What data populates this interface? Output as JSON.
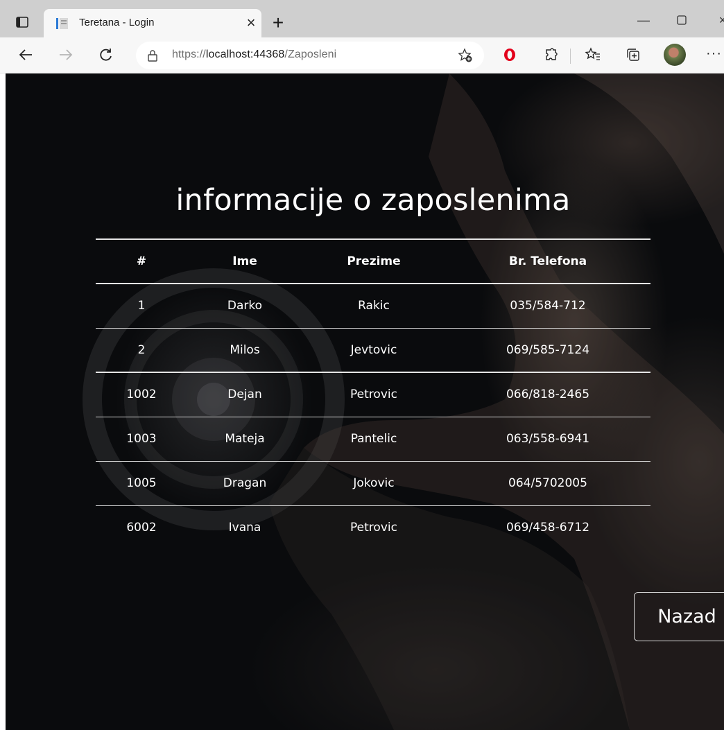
{
  "browser": {
    "tab_title": "Teretana - Login",
    "url_scheme": "https://",
    "url_host": "localhost:44368",
    "url_path": "/Zaposleni",
    "icons": [
      "tab-actions-icon",
      "favicon-icon",
      "close-icon",
      "plus-icon",
      "minimize-icon",
      "maximize-icon",
      "back-icon",
      "forward-icon",
      "refresh-icon",
      "lock-icon",
      "add-favorite-icon",
      "opera-icon",
      "extensions-icon",
      "favorites-icon",
      "collections-icon",
      "profile-avatar",
      "more-icon"
    ]
  },
  "page": {
    "heading": "informacije o zaposlenima",
    "table": {
      "columns": [
        "#",
        "Ime",
        "Prezime",
        "Br. Telefona"
      ],
      "rows": [
        [
          "1",
          "Darko",
          "Rakic",
          "035/584-712"
        ],
        [
          "2",
          "Milos",
          "Jevtovic",
          "069/585-7124"
        ],
        [
          "1002",
          "Dejan",
          "Petrovic",
          "066/818-2465"
        ],
        [
          "1003",
          "Mateja",
          "Pantelic",
          "063/558-6941"
        ],
        [
          "1005",
          "Dragan",
          "Jokovic",
          "064/5702005"
        ],
        [
          "6002",
          "Ivana",
          "Petrovic",
          "069/458-6712"
        ]
      ]
    },
    "back_button": "Nazad"
  }
}
